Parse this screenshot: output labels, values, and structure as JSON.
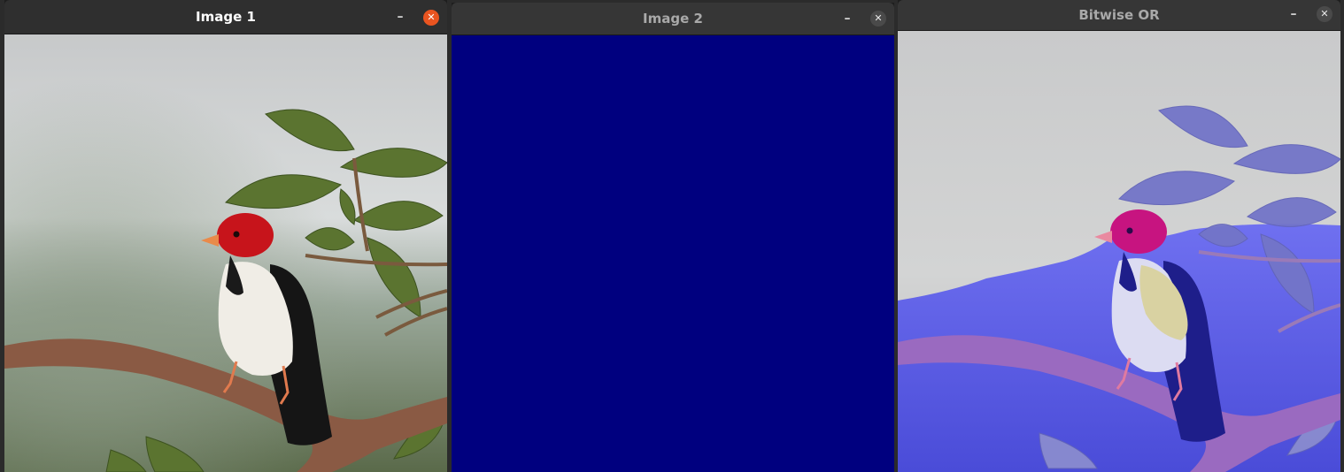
{
  "windows": [
    {
      "title": "Image 1",
      "minimize_glyph": "–",
      "close_glyph": "✕",
      "state": "active"
    },
    {
      "title": "Image 2",
      "minimize_glyph": "–",
      "close_glyph": "✕",
      "state": "inactive"
    },
    {
      "title": "Bitwise OR",
      "minimize_glyph": "–",
      "close_glyph": "✕",
      "state": "inactive"
    }
  ],
  "colors": {
    "image2_fill": "#00007f",
    "titlebar_bg": "#323232",
    "close_active": "#e95420",
    "sky_top": "#c9cacb",
    "foliage_green": "#4f6b2a",
    "bird_head_red": "#c7141b",
    "bird_beak_orange": "#e98a4a",
    "branch_brown": "#8a5a44",
    "or_blue_overlay": "#5a5ce6"
  },
  "icons": [
    "minimize-icon",
    "close-icon"
  ]
}
